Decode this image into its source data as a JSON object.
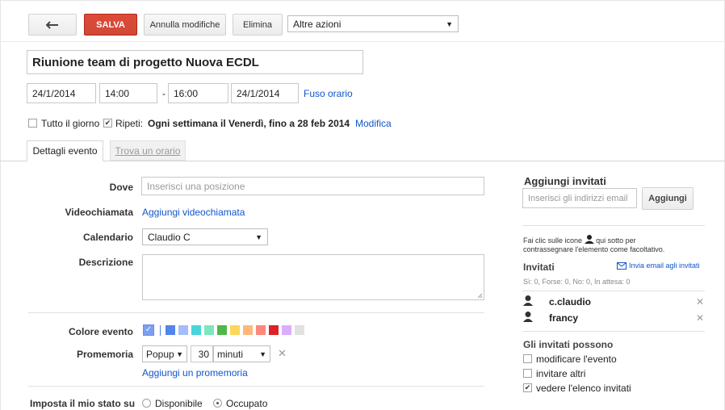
{
  "toolbar": {
    "back_icon": "arrow-left-icon",
    "save_label": "SALVA",
    "cancel_label": "Annulla modifiche",
    "delete_label": "Elimina",
    "more_actions_label": "Altre azioni"
  },
  "event": {
    "title": "Riunione team di progetto Nuova ECDL",
    "start_date": "24/1/2014",
    "start_time": "14:00",
    "dash": "-",
    "end_time": "16:00",
    "end_date": "24/1/2014",
    "timezone_link": "Fuso orario",
    "all_day_label": "Tutto il giorno",
    "all_day_checked": false,
    "repeat_label": "Ripeti:",
    "repeat_checked": true,
    "repeat_summary": "Ogni settimana il Venerdì, fino a 28 feb 2014",
    "repeat_edit_link": "Modifica"
  },
  "tabs": [
    {
      "label": "Dettagli evento",
      "active": true
    },
    {
      "label": "Trova un orario",
      "active": false
    }
  ],
  "details": {
    "where_label": "Dove",
    "where_placeholder": "Inserisci una posizione",
    "video_label": "Videochiamata",
    "video_link": "Aggiungi videochiamata",
    "calendar_label": "Calendario",
    "calendar_value": "Claudio C",
    "description_label": "Descrizione",
    "color_label": "Colore evento",
    "reminder_label": "Promemoria",
    "reminder_type": "Popup",
    "reminder_amount": "30",
    "reminder_unit": "minuti",
    "add_reminder_link": "Aggiungi un promemoria",
    "status_label": "Imposta il mio stato su",
    "status_options": [
      {
        "label": "Disponibile",
        "selected": false
      },
      {
        "label": "Occupato",
        "selected": true
      }
    ]
  },
  "colors": {
    "selected": "#7c9ff0",
    "swatches": [
      "#5484ed",
      "#a4bdfc",
      "#46d6db",
      "#7ae7bf",
      "#51b749",
      "#fbd75b",
      "#ffb878",
      "#ff887c",
      "#dc2127",
      "#dbadff",
      "#e1e1e1"
    ],
    "accent_red": "#d14836",
    "link_blue": "#1155cc"
  },
  "guests": {
    "add_title": "Aggiungi invitati",
    "input_placeholder": "Inserisci gli indirizzi email",
    "add_button": "Aggiungi",
    "hint_before_icon": "Fai clic sulle icone",
    "hint_after_icon": "qui sotto per",
    "hint_line2": "contrassegnare l'elemento come facoltativo.",
    "invited_title": "Invitati",
    "email_link": "Invia email agli invitati",
    "counts": "Sì: 0, Forse: 0, No: 0, In attesa: 0",
    "list": [
      {
        "name": "c.claudio"
      },
      {
        "name": "francy"
      }
    ],
    "permissions_title": "Gli invitati possono",
    "permissions": [
      {
        "label": "modificare l'evento",
        "checked": false
      },
      {
        "label": "invitare altri",
        "checked": false
      },
      {
        "label": "vedere l'elenco invitati",
        "checked": true
      }
    ]
  }
}
